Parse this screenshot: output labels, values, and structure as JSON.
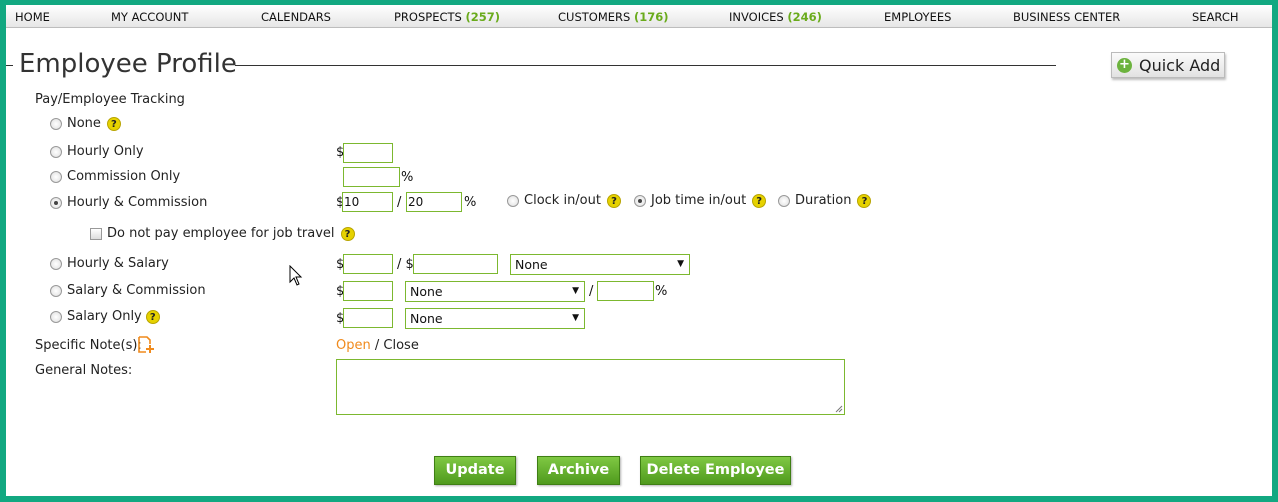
{
  "nav": [
    {
      "label": "HOME",
      "count": ""
    },
    {
      "label": "MY ACCOUNT",
      "count": ""
    },
    {
      "label": "CALENDARS",
      "count": ""
    },
    {
      "label": "PROSPECTS",
      "count": "(257)"
    },
    {
      "label": "CUSTOMERS",
      "count": "(176)"
    },
    {
      "label": "INVOICES",
      "count": "(246)"
    },
    {
      "label": "EMPLOYEES",
      "count": ""
    },
    {
      "label": "BUSINESS CENTER",
      "count": ""
    },
    {
      "label": "SEARCH",
      "count": ""
    }
  ],
  "header": {
    "title": "Employee Profile",
    "quick_add": "Quick Add"
  },
  "pay": {
    "section_label": "Pay/Employee Tracking",
    "options": {
      "none": "None",
      "hourly_only": "Hourly Only",
      "commission_only": "Commission Only",
      "hourly_commission": "Hourly & Commission",
      "hourly_salary": "Hourly & Salary",
      "salary_commission": "Salary & Commission",
      "salary_only": "Salary Only"
    },
    "selected": "hourly_commission",
    "travel_checkbox": "Do not pay employee for job travel",
    "currency": "$",
    "percent": "%",
    "slash": "/",
    "slash_dollar": "/ $",
    "hourly_commission_values": {
      "hourly": "10",
      "commission": "20"
    },
    "tracking": {
      "clock": "Clock in/out",
      "job_time": "Job time in/out",
      "duration": "Duration",
      "selected": "job_time"
    },
    "select_value": "None",
    "help_glyph": "?"
  },
  "notes": {
    "specific_label": "Specific Note(s):",
    "open": "Open",
    "close_sep": "/",
    "close": "Close",
    "general_label": "General Notes:"
  },
  "buttons": {
    "update": "Update",
    "archive": "Archive",
    "delete": "Delete Employee"
  },
  "colors": {
    "frame": "#12a881",
    "accent_green": "#6aab1c",
    "link_orange": "#f08a1c",
    "help_yellow": "#e6d200"
  }
}
